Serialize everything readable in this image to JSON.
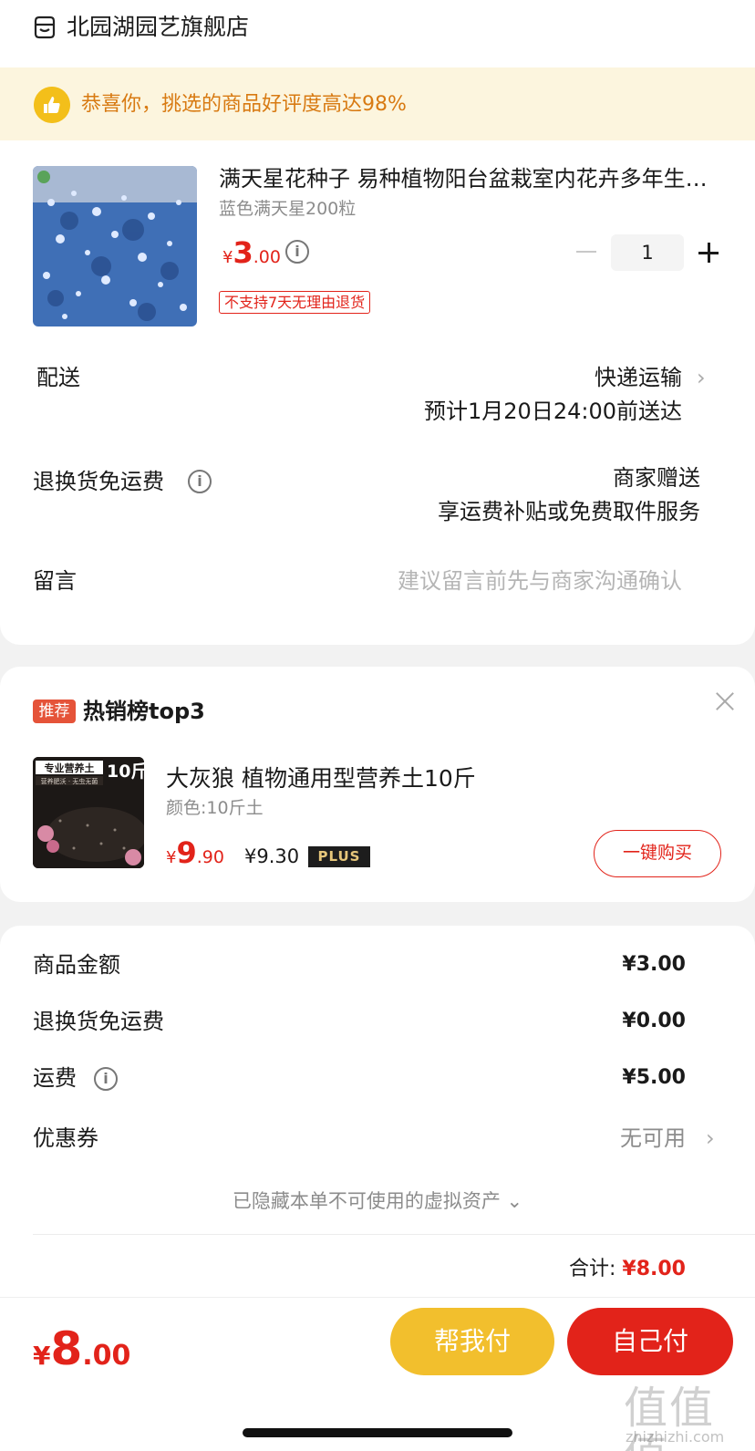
{
  "shop": {
    "name": "北园湖园艺旗舰店",
    "icon": "shop-icon"
  },
  "banner": {
    "text": "恭喜你，挑选的商品好评度高达98%",
    "icon": "thumbs-up-icon"
  },
  "product": {
    "title": "满天星花种子 易种植物阳台盆栽室内花卉多年生四季种籽子",
    "variant": "蓝色满天星200粒",
    "price_currency": "¥",
    "price_int": "3",
    "price_dec": ".00",
    "no_return_tag": "不支持7天无理由退货",
    "quantity": "1"
  },
  "delivery": {
    "label": "配送",
    "method": "快递运输",
    "eta": "预计1月20日24:00前送达"
  },
  "return_shipping": {
    "label": "退换货免运费",
    "value": "商家赠送",
    "desc": "享运费补贴或免费取件服务"
  },
  "message": {
    "label": "留言",
    "placeholder": "建议留言前先与商家沟通确认"
  },
  "recommend": {
    "tag": "推荐",
    "title": "热销榜top3",
    "item": {
      "name": "大灰狼 植物通用型营养土10斤",
      "variant": "颜色:10斤土",
      "price_currency": "¥",
      "price_int": "9",
      "price_dec": ".90",
      "plus_price": "¥9.30",
      "plus_badge": "PLUS",
      "buy_label": "一键购买",
      "image_text_main": "专业营养土",
      "image_text_weight": "10斤",
      "image_text_sub": "营养肥沃 · 无虫无菌"
    }
  },
  "summary": {
    "rows": [
      {
        "label": "商品金额",
        "value": "¥3.00"
      },
      {
        "label": "退换货免运费",
        "value": "¥0.00"
      },
      {
        "label": "运费",
        "value": "¥5.00"
      },
      {
        "label": "优惠券",
        "value": "无可用"
      }
    ],
    "hidden_assets": "已隐藏本单不可使用的虚拟资产",
    "total_label": "合计:",
    "total_value": "¥8.00"
  },
  "bottom": {
    "price_currency": "¥",
    "price_int": "8",
    "price_dec": ".00",
    "help_pay": "帮我付",
    "self_pay": "自己付"
  },
  "watermark": {
    "text": "值值值",
    "url": "zhizhizhi.com"
  },
  "colors": {
    "accent": "#e2231a",
    "gold": "#f2bf2d",
    "banner_bg": "#fcf5de",
    "banner_text": "#d87a12"
  }
}
